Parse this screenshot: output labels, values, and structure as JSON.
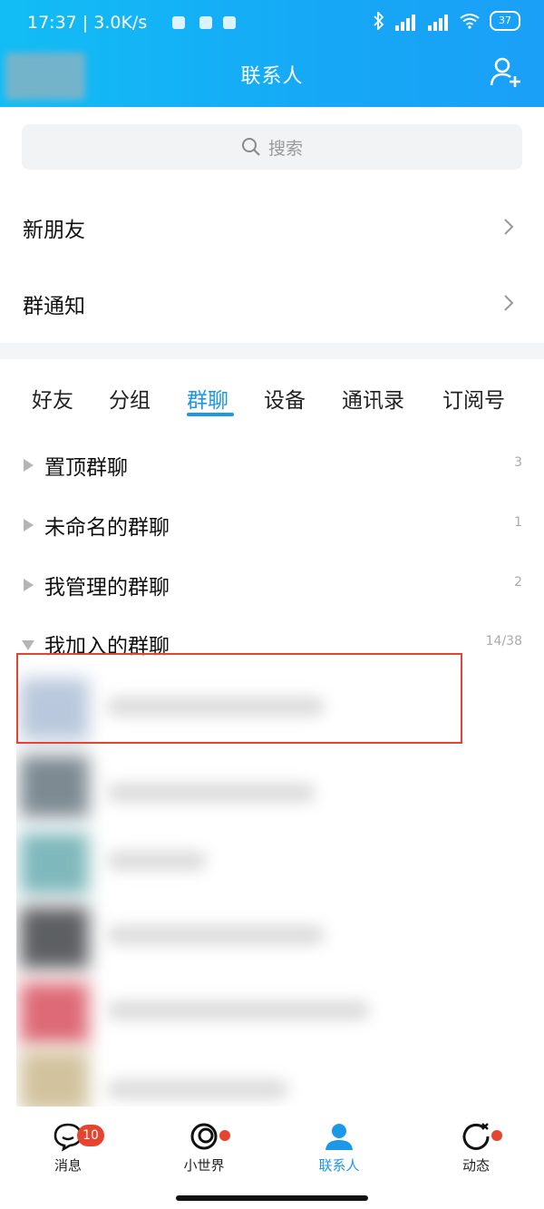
{
  "status_bar": {
    "time_speed": "17:37 | 3.0K/s",
    "hd1": "HD",
    "hd2": "HD",
    "battery": "37"
  },
  "header": {
    "title": "联系人",
    "add_icon": "add-contact-icon"
  },
  "search": {
    "placeholder": "搜索"
  },
  "menu_rows": [
    {
      "label": "新朋友"
    },
    {
      "label": "群通知"
    }
  ],
  "tabs": [
    "好友",
    "分组",
    "群聊",
    "设备",
    "通讯录",
    "订阅号"
  ],
  "active_tab": "群聊",
  "groups": [
    {
      "label": "置顶群聊",
      "count": "3",
      "expanded": false
    },
    {
      "label": "未命名的群聊",
      "count": "1",
      "expanded": false
    },
    {
      "label": "我管理的群聊",
      "count": "2",
      "expanded": false
    },
    {
      "label": "我加入的群聊",
      "count": "14/38",
      "expanded": true
    }
  ],
  "tabbar": [
    {
      "label": "消息",
      "badge": "10"
    },
    {
      "label": "小世界"
    },
    {
      "label": "联系人"
    },
    {
      "label": "动态"
    }
  ],
  "colors": {
    "accent": "#1d97e8",
    "header_start": "#12bdf5",
    "header_end": "#1aa0f7",
    "badge": "#e5452f",
    "highlight_box": "#e5452f"
  }
}
